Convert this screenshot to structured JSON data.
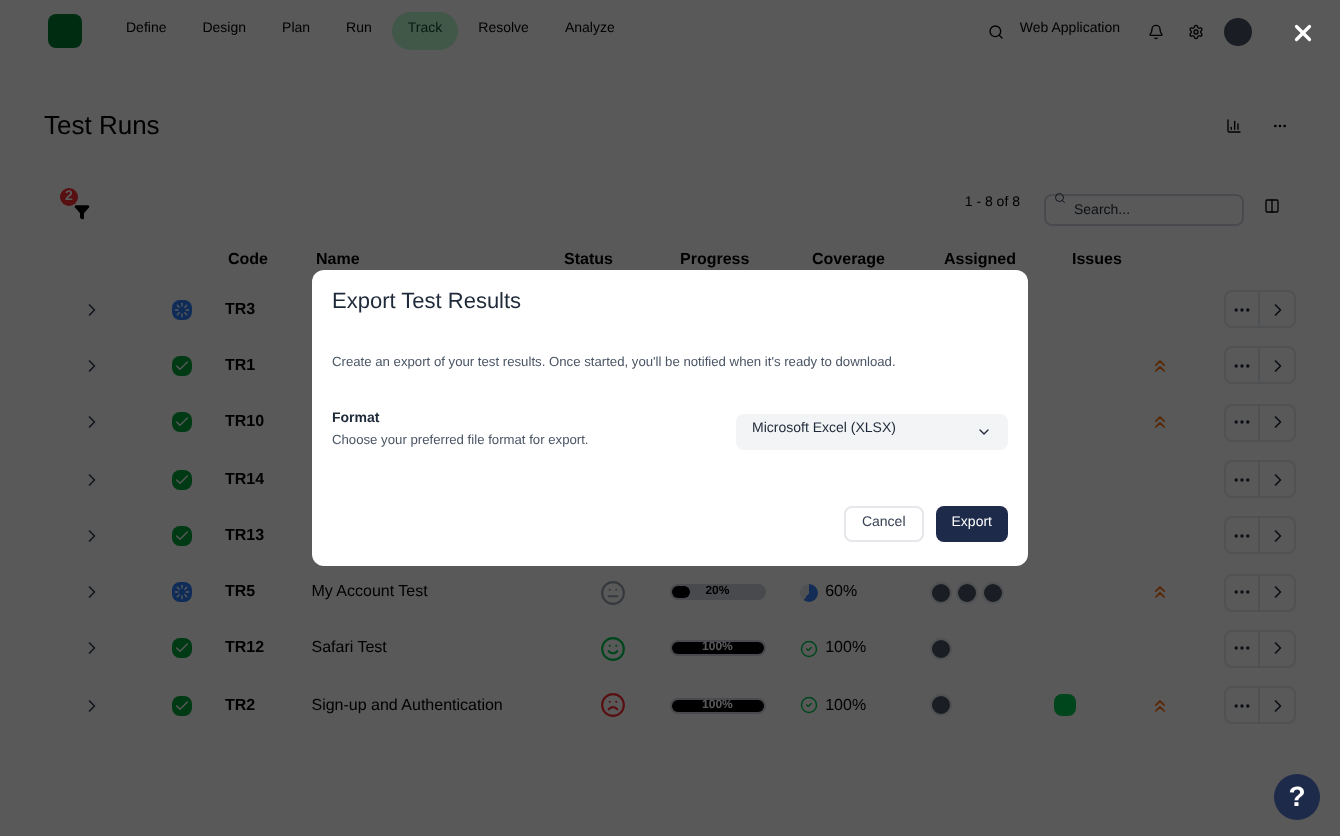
{
  "nav": {
    "items": [
      {
        "label": "Define",
        "selected": false
      },
      {
        "label": "Design",
        "selected": false
      },
      {
        "label": "Plan",
        "selected": false
      },
      {
        "label": "Run",
        "selected": false
      },
      {
        "label": "Track",
        "selected": true
      },
      {
        "label": "Resolve",
        "selected": false
      },
      {
        "label": "Analyze",
        "selected": false
      }
    ],
    "project": "Web Application"
  },
  "page": {
    "title": "Test Runs"
  },
  "toolbar": {
    "filter_count": "2",
    "pagination": "1 - 8 of 8",
    "search": {
      "placeholder": "Search..."
    }
  },
  "table": {
    "columns": [
      "Code",
      "Name",
      "Status",
      "Progress",
      "Coverage",
      "Assigned",
      "Issues"
    ],
    "rows": [
      {
        "code": "TR3",
        "kind": "active",
        "high_priority": false,
        "issue_badge": false
      },
      {
        "code": "TR1",
        "kind": "done",
        "high_priority": true,
        "issue_badge": false
      },
      {
        "code": "TR10",
        "kind": "done",
        "high_priority": true,
        "issue_badge": false
      },
      {
        "code": "TR14",
        "kind": "done",
        "high_priority": false,
        "issue_badge": false
      },
      {
        "code": "TR13",
        "kind": "done",
        "high_priority": false,
        "issue_badge": false
      },
      {
        "code": "TR5",
        "kind": "active",
        "name": "My Account Test",
        "status": {
          "kind": "neutral"
        },
        "progress": {
          "level": 0.2,
          "label": "20%"
        },
        "coverage": {
          "kind": "partial",
          "label": "60%"
        },
        "assigned": [
          {
            "kind": "avatar"
          },
          {
            "kind": "avatar"
          },
          {
            "kind": "avatar"
          }
        ],
        "high_priority": true,
        "issue_badge": false
      },
      {
        "code": "TR12",
        "kind": "done",
        "name": "Safari Test",
        "status": {
          "kind": "happy"
        },
        "progress": {
          "level": 1,
          "label": "100%"
        },
        "coverage": {
          "kind": "complete",
          "label": "100%"
        },
        "assigned": [
          {
            "kind": "avatar"
          }
        ],
        "high_priority": false,
        "issue_badge": false
      },
      {
        "code": "TR2",
        "kind": "done",
        "name": "Sign-up and Authentication",
        "status": {
          "kind": "sad"
        },
        "progress": {
          "level": 1,
          "label": "100%"
        },
        "coverage": {
          "kind": "complete",
          "label": "100%"
        },
        "assigned": [
          {
            "kind": "avatar"
          }
        ],
        "high_priority": true,
        "issue_badge": true
      }
    ]
  },
  "dialog": {
    "title": "Export Test Results",
    "description": "Create an export of your test results. Once started, you'll be notified when it's ready to download.",
    "field_label": "Format",
    "field_hint": "Choose your preferred file format for export.",
    "format_value": "Microsoft Excel (XLSX)",
    "buttons": [
      {
        "label": "Cancel",
        "kind": "secondary"
      },
      {
        "label": "Export",
        "kind": "primary"
      }
    ]
  },
  "help": {
    "label": "?"
  }
}
